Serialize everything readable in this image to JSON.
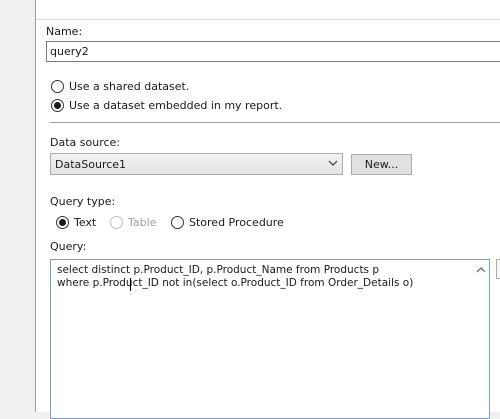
{
  "name": {
    "label": "Name:",
    "value": "query2"
  },
  "dataset_options": [
    {
      "label": "Use a shared dataset.",
      "checked": false
    },
    {
      "label": "Use a dataset embedded in my report.",
      "checked": true
    }
  ],
  "data_source": {
    "label": "Data source:",
    "selected": "DataSource1",
    "new_button": "New..."
  },
  "query_type": {
    "label": "Query type:",
    "options": [
      {
        "label": "Text",
        "checked": true,
        "enabled": true
      },
      {
        "label": "Table",
        "checked": false,
        "enabled": false
      },
      {
        "label": "Stored Procedure",
        "checked": false,
        "enabled": true
      }
    ]
  },
  "query": {
    "label": "Query:",
    "lines": [
      "select distinct p.Product_ID, p.Product_Name from Products p",
      "where p.Product_ID not in(select o.Product_ID from Order_Details o)"
    ]
  },
  "colors": {
    "focus_border": "#7a9fcf",
    "separator": "#a0a0a0",
    "button_bg": "#e1e1e1"
  }
}
